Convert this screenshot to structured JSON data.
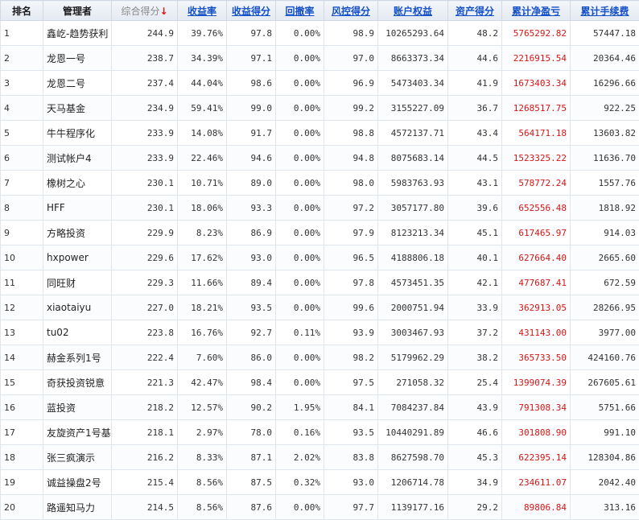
{
  "headers": {
    "rank": "排名",
    "manager": "管理者",
    "total": "综合得分",
    "sort_arrow": "↓",
    "return_rate": "收益率",
    "return_score": "收益得分",
    "drawdown": "回撤率",
    "risk_score": "风控得分",
    "equity": "账户权益",
    "asset_score": "资产得分",
    "pnl": "累计净盈亏",
    "fees": "累计手续费"
  },
  "colors": {
    "pnl_red": "#d81414",
    "link_blue": "#1450c8",
    "sort_arrow_red": "#e01010"
  },
  "rows": [
    {
      "rank": "1",
      "name": "鑫屹-趋势获利",
      "total": "244.9",
      "rr": "39.76%",
      "rs": "97.8",
      "dd": "0.00%",
      "risk": "98.9",
      "eq": "10265293.64",
      "as": "48.2",
      "pnl": "5765292.82",
      "fee": "57447.18"
    },
    {
      "rank": "2",
      "name": "龙恩一号",
      "total": "238.7",
      "rr": "34.39%",
      "rs": "97.1",
      "dd": "0.00%",
      "risk": "97.0",
      "eq": "8663373.34",
      "as": "44.6",
      "pnl": "2216915.54",
      "fee": "20364.46"
    },
    {
      "rank": "3",
      "name": "龙恩二号",
      "total": "237.4",
      "rr": "44.04%",
      "rs": "98.6",
      "dd": "0.00%",
      "risk": "96.9",
      "eq": "5473403.34",
      "as": "41.9",
      "pnl": "1673403.34",
      "fee": "16296.66"
    },
    {
      "rank": "4",
      "name": "天马基金",
      "total": "234.9",
      "rr": "59.41%",
      "rs": "99.0",
      "dd": "0.00%",
      "risk": "99.2",
      "eq": "3155227.09",
      "as": "36.7",
      "pnl": "1268517.75",
      "fee": "922.25"
    },
    {
      "rank": "5",
      "name": "牛牛程序化",
      "total": "233.9",
      "rr": "14.08%",
      "rs": "91.7",
      "dd": "0.00%",
      "risk": "98.8",
      "eq": "4572137.71",
      "as": "43.4",
      "pnl": "564171.18",
      "fee": "13603.82"
    },
    {
      "rank": "6",
      "name": "测试帐户4",
      "total": "233.9",
      "rr": "22.46%",
      "rs": "94.6",
      "dd": "0.00%",
      "risk": "94.8",
      "eq": "8075683.14",
      "as": "44.5",
      "pnl": "1523325.22",
      "fee": "11636.70"
    },
    {
      "rank": "7",
      "name": "橡树之心",
      "total": "230.1",
      "rr": "10.71%",
      "rs": "89.0",
      "dd": "0.00%",
      "risk": "98.0",
      "eq": "5983763.93",
      "as": "43.1",
      "pnl": "578772.24",
      "fee": "1557.76"
    },
    {
      "rank": "8",
      "name": "HFF",
      "total": "230.1",
      "rr": "18.06%",
      "rs": "93.3",
      "dd": "0.00%",
      "risk": "97.2",
      "eq": "3057177.80",
      "as": "39.6",
      "pnl": "652556.48",
      "fee": "1818.92"
    },
    {
      "rank": "9",
      "name": "方略投资",
      "total": "229.9",
      "rr": "8.23%",
      "rs": "86.9",
      "dd": "0.00%",
      "risk": "97.9",
      "eq": "8123213.34",
      "as": "45.1",
      "pnl": "617465.97",
      "fee": "914.03"
    },
    {
      "rank": "10",
      "name": "hxpower",
      "total": "229.6",
      "rr": "17.62%",
      "rs": "93.0",
      "dd": "0.00%",
      "risk": "96.5",
      "eq": "4188806.18",
      "as": "40.1",
      "pnl": "627664.40",
      "fee": "2665.60"
    },
    {
      "rank": "11",
      "name": "同旺财",
      "total": "229.3",
      "rr": "11.66%",
      "rs": "89.4",
      "dd": "0.00%",
      "risk": "97.8",
      "eq": "4573451.35",
      "as": "42.1",
      "pnl": "477687.41",
      "fee": "672.59"
    },
    {
      "rank": "12",
      "name": "xiaotaiyu",
      "total": "227.0",
      "rr": "18.21%",
      "rs": "93.5",
      "dd": "0.00%",
      "risk": "99.6",
      "eq": "2000751.94",
      "as": "33.9",
      "pnl": "362913.05",
      "fee": "28266.95"
    },
    {
      "rank": "13",
      "name": "tu02",
      "total": "223.8",
      "rr": "16.76%",
      "rs": "92.7",
      "dd": "0.11%",
      "risk": "93.9",
      "eq": "3003467.93",
      "as": "37.2",
      "pnl": "431143.00",
      "fee": "3977.00"
    },
    {
      "rank": "14",
      "name": "赫金系列1号",
      "total": "222.4",
      "rr": "7.60%",
      "rs": "86.0",
      "dd": "0.00%",
      "risk": "98.2",
      "eq": "5179962.29",
      "as": "38.2",
      "pnl": "365733.50",
      "fee": "424160.76"
    },
    {
      "rank": "15",
      "name": "奇获投资锐意",
      "total": "221.3",
      "rr": "42.47%",
      "rs": "98.4",
      "dd": "0.00%",
      "risk": "97.5",
      "eq": "271058.32",
      "as": "25.4",
      "pnl": "1399074.39",
      "fee": "267605.61"
    },
    {
      "rank": "16",
      "name": "蓝投资",
      "total": "218.2",
      "rr": "12.57%",
      "rs": "90.2",
      "dd": "1.95%",
      "risk": "84.1",
      "eq": "7084237.84",
      "as": "43.9",
      "pnl": "791308.34",
      "fee": "5751.66"
    },
    {
      "rank": "17",
      "name": "友旋资产1号基:",
      "total": "218.1",
      "rr": "2.97%",
      "rs": "78.0",
      "dd": "0.16%",
      "risk": "93.5",
      "eq": "10440291.89",
      "as": "46.6",
      "pnl": "301808.90",
      "fee": "991.10"
    },
    {
      "rank": "18",
      "name": "张三疯演示",
      "total": "216.2",
      "rr": "8.33%",
      "rs": "87.1",
      "dd": "2.02%",
      "risk": "83.8",
      "eq": "8627598.70",
      "as": "45.3",
      "pnl": "622395.14",
      "fee": "128304.86"
    },
    {
      "rank": "19",
      "name": "诚益操盘2号",
      "total": "215.4",
      "rr": "8.56%",
      "rs": "87.5",
      "dd": "0.32%",
      "risk": "93.0",
      "eq": "1206714.78",
      "as": "34.9",
      "pnl": "234611.07",
      "fee": "2042.40"
    },
    {
      "rank": "20",
      "name": "路遥知马力",
      "total": "214.5",
      "rr": "8.56%",
      "rs": "87.6",
      "dd": "0.00%",
      "risk": "97.7",
      "eq": "1139177.16",
      "as": "29.2",
      "pnl": "89806.84",
      "fee": "313.16"
    }
  ]
}
